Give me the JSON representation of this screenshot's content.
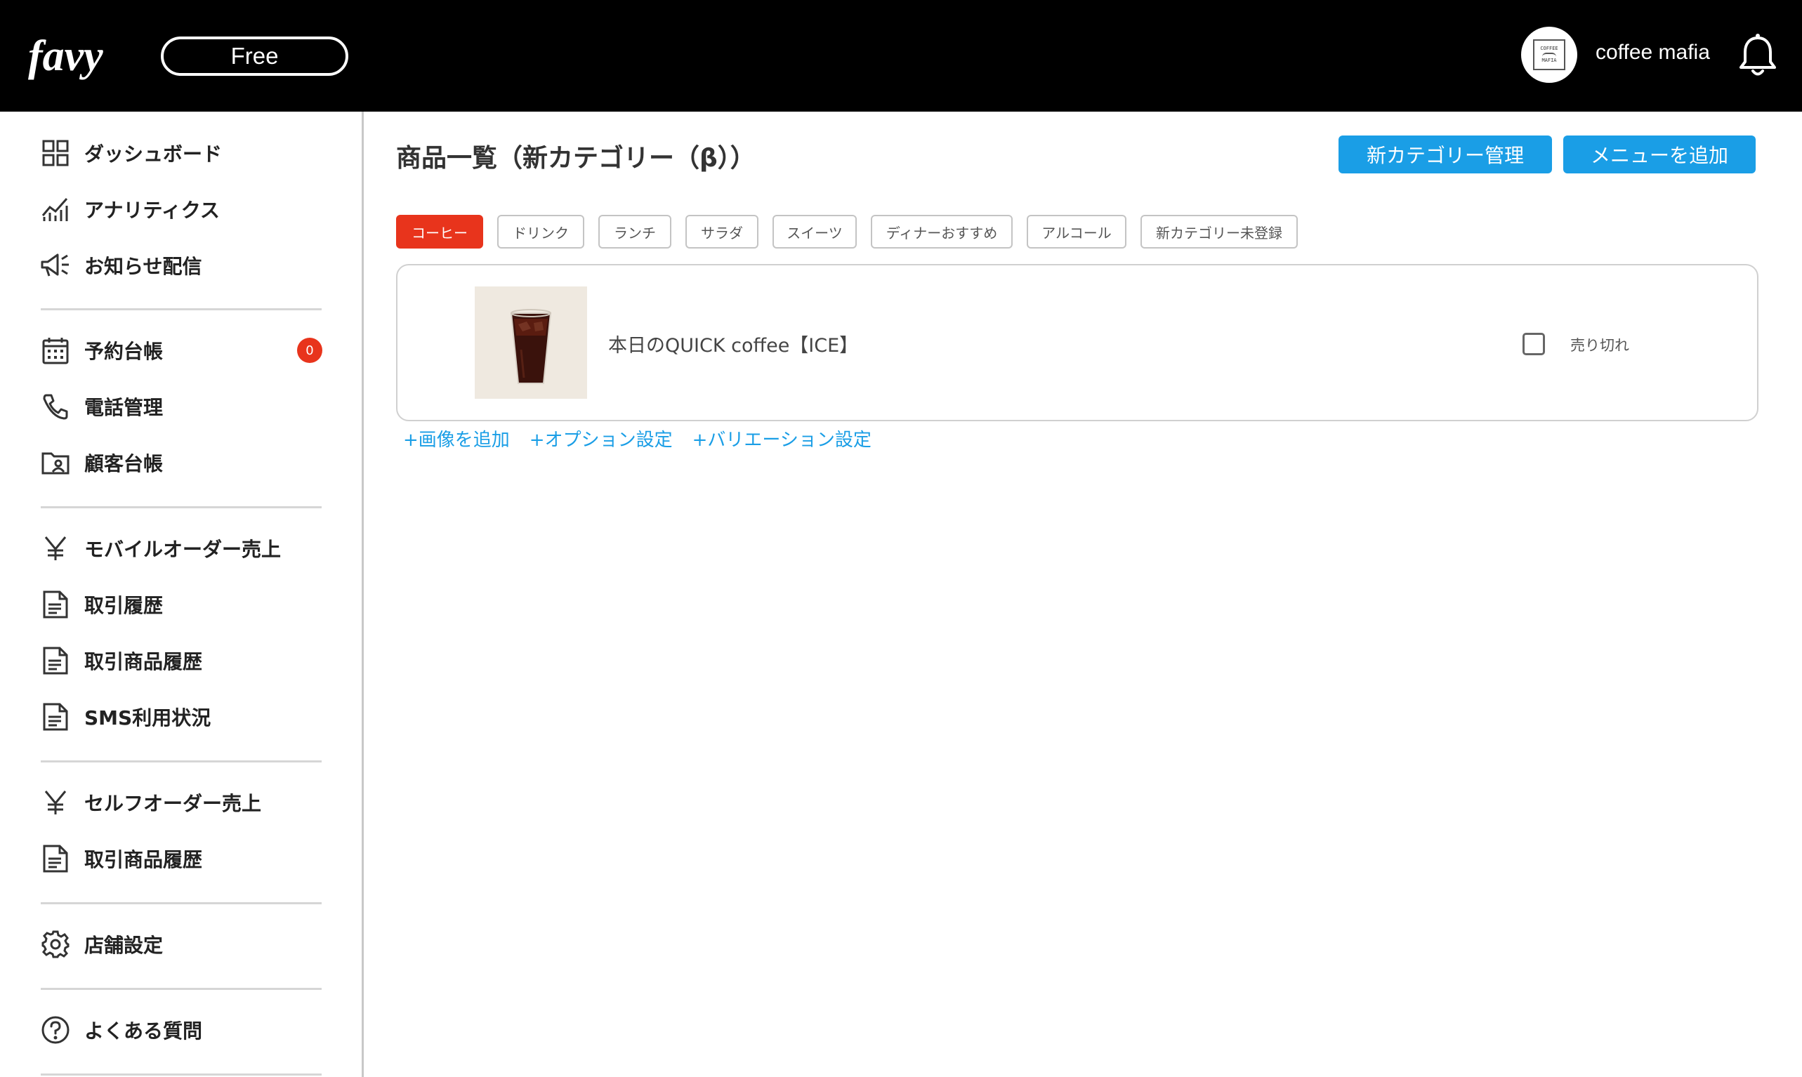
{
  "header": {
    "logo_text": "favy",
    "plan": "Free",
    "avatar_text": [
      "COFFEE",
      "MAFIA"
    ],
    "shop_name": "coffee mafia"
  },
  "sidebar": {
    "items": [
      {
        "label": "ダッシュボード",
        "icon": "dashboard-grid-icon"
      },
      {
        "label": "アナリティクス",
        "icon": "analytics-chart-icon"
      },
      {
        "label": "お知らせ配信",
        "icon": "megaphone-icon"
      },
      {
        "label": "予約台帳",
        "icon": "calendar-icon",
        "badge": "0"
      },
      {
        "label": "電話管理",
        "icon": "phone-icon"
      },
      {
        "label": "顧客台帳",
        "icon": "customer-folder-icon"
      },
      {
        "label": "モバイルオーダー売上",
        "icon": "yen-icon"
      },
      {
        "label": "取引履歴",
        "icon": "document-icon"
      },
      {
        "label": "取引商品履歴",
        "icon": "document-icon"
      },
      {
        "label": "SMS利用状況",
        "icon": "document-icon"
      },
      {
        "label": "セルフオーダー売上",
        "icon": "yen-icon"
      },
      {
        "label": "取引商品履歴",
        "icon": "document-icon"
      },
      {
        "label": "店舗設定",
        "icon": "gear-icon"
      },
      {
        "label": "よくある質問",
        "icon": "question-icon"
      }
    ]
  },
  "main": {
    "title": "商品一覧（新カテゴリー（β））",
    "buttons": {
      "category_manage": "新カテゴリー管理",
      "add_menu": "メニューを追加"
    },
    "tabs": [
      "コーヒー",
      "ドリンク",
      "ランチ",
      "サラダ",
      "スイーツ",
      "ディナーおすすめ",
      "アルコール",
      "新カテゴリー未登録"
    ],
    "active_tab": "コーヒー",
    "product": {
      "name": "本日のQUICK coffee【ICE】",
      "sold_out_label": "売り切れ",
      "sold_out": false
    },
    "links": [
      "+画像を追加",
      "+オプション設定",
      "+バリエーション設定"
    ]
  },
  "colors": {
    "accent_blue": "#1a9ee6",
    "accent_red": "#e8341c",
    "header_bg": "#000000"
  }
}
